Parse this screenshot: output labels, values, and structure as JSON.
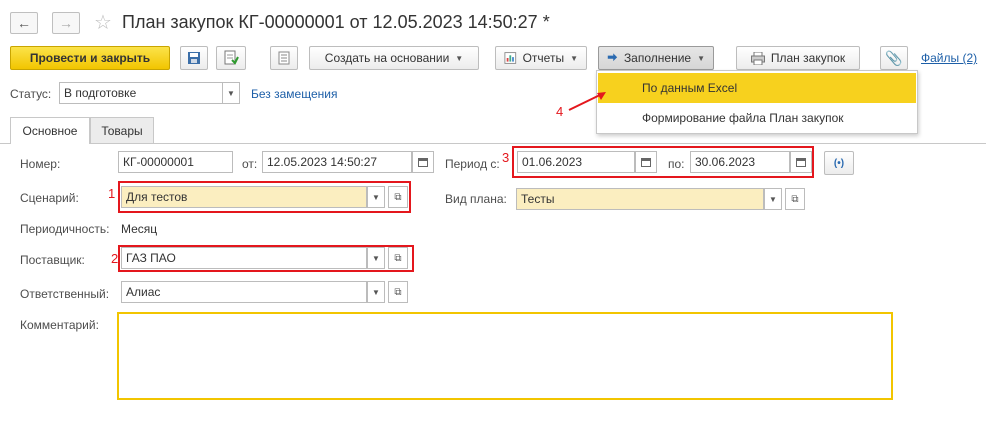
{
  "window": {
    "title": "План закупок КГ-00000001 от 12.05.2023 14:50:27 *"
  },
  "toolbar": {
    "post_close": "Провести и закрыть",
    "create_based": "Создать на основании",
    "reports": "Отчеты",
    "fill": "Заполнение",
    "purchase_plan": "План закупок",
    "files": "Файлы (2)"
  },
  "fill_menu": {
    "items": [
      "По данным Excel",
      "Формирование файла План закупок"
    ]
  },
  "status": {
    "label": "Статус:",
    "value": "В подготовке",
    "replacement_link": "Без замещения"
  },
  "tabs": [
    "Основное",
    "Товары"
  ],
  "form": {
    "number_label": "Номер:",
    "number_value": "КГ-00000001",
    "date_label": "от:",
    "date_value": "12.05.2023 14:50:27",
    "period_label": "Период с:",
    "period_from": "01.06.2023",
    "period_to_label": "по:",
    "period_to": "30.06.2023",
    "scenario_label": "Сценарий:",
    "scenario_value": "Для тестов",
    "plan_type_label": "Вид плана:",
    "plan_type_value": "Тесты",
    "periodicity_label": "Периодичность:",
    "periodicity_value": "Месяц",
    "supplier_label": "Поставщик:",
    "supplier_value": "ГАЗ ПАО",
    "responsible_label": "Ответственный:",
    "responsible_value": "Алиас",
    "comment_label": "Комментарий:",
    "comment_value": ""
  },
  "annotations": [
    "1",
    "2",
    "3",
    "4"
  ],
  "colors": {
    "accent_yellow": "#f7d11e",
    "highlight_red": "#e4171d",
    "link_blue": "#1d5fa8",
    "field_yellow": "#fbeec0"
  }
}
